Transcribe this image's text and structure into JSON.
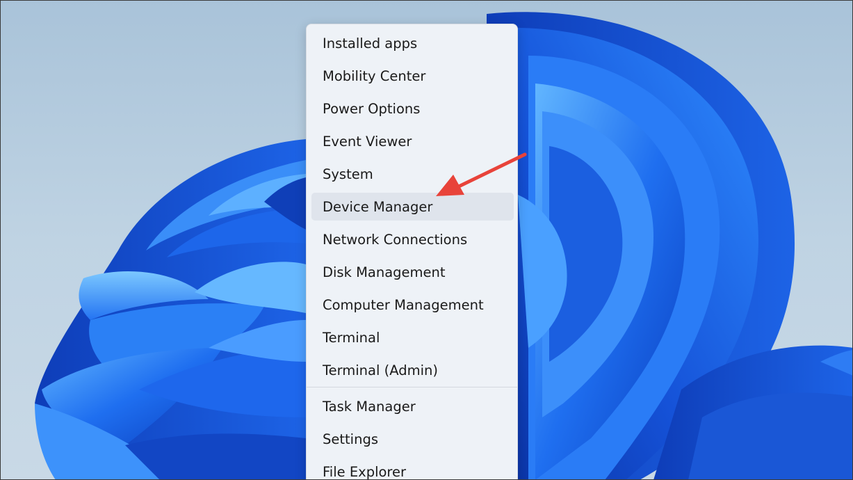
{
  "context_menu": {
    "items": [
      {
        "label": "Installed apps"
      },
      {
        "label": "Mobility Center"
      },
      {
        "label": "Power Options"
      },
      {
        "label": "Event Viewer"
      },
      {
        "label": "System"
      },
      {
        "label": "Device Manager",
        "highlighted": true
      },
      {
        "label": "Network Connections"
      },
      {
        "label": "Disk Management"
      },
      {
        "label": "Computer Management"
      },
      {
        "label": "Terminal"
      },
      {
        "label": "Terminal (Admin)"
      },
      {
        "label": "Task Manager"
      },
      {
        "label": "Settings"
      },
      {
        "label": "File Explorer"
      }
    ]
  },
  "annotation": {
    "arrow_color": "#e8433a",
    "points_to": "Device Manager"
  },
  "colors": {
    "wallpaper_sky": "#bcd0e1",
    "bloom_blue": "#1e6cf0",
    "menu_background": "#eef2f7",
    "highlight": "#dfe4ec"
  }
}
